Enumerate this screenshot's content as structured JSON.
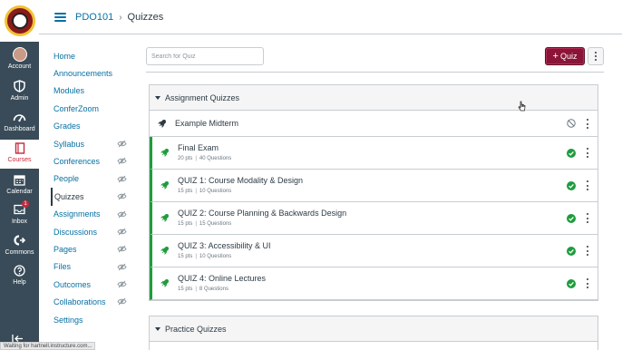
{
  "global_nav": {
    "items": [
      {
        "label": "Account",
        "icon": "avatar"
      },
      {
        "label": "Admin",
        "icon": "shield-icon"
      },
      {
        "label": "Dashboard",
        "icon": "dashboard-icon"
      },
      {
        "label": "Courses",
        "icon": "book-icon"
      },
      {
        "label": "Calendar",
        "icon": "calendar-icon"
      },
      {
        "label": "Inbox",
        "icon": "inbox-icon",
        "badge": "1"
      },
      {
        "label": "Commons",
        "icon": "commons-icon"
      },
      {
        "label": "Help",
        "icon": "help-icon"
      }
    ],
    "active": "Courses"
  },
  "header": {
    "course": "PDO101",
    "page": "Quizzes"
  },
  "course_nav": {
    "items": [
      {
        "label": "Home",
        "hidden": false
      },
      {
        "label": "Announcements",
        "hidden": false
      },
      {
        "label": "Modules",
        "hidden": false
      },
      {
        "label": "ConferZoom",
        "hidden": false
      },
      {
        "label": "Grades",
        "hidden": false
      },
      {
        "label": "Syllabus",
        "hidden": true
      },
      {
        "label": "Conferences",
        "hidden": true
      },
      {
        "label": "People",
        "hidden": true
      },
      {
        "label": "Quizzes",
        "hidden": true,
        "active": true
      },
      {
        "label": "Assignments",
        "hidden": true
      },
      {
        "label": "Discussions",
        "hidden": true
      },
      {
        "label": "Pages",
        "hidden": true
      },
      {
        "label": "Files",
        "hidden": true
      },
      {
        "label": "Outcomes",
        "hidden": true
      },
      {
        "label": "Collaborations",
        "hidden": true
      },
      {
        "label": "Settings",
        "hidden": false
      }
    ]
  },
  "toolbar": {
    "search_placeholder": "Search for Quiz",
    "add_quiz_label": "Quiz"
  },
  "assignment_group": {
    "title": "Assignment Quizzes",
    "quizzes": [
      {
        "title": "Example Midterm",
        "points": "",
        "questions": "",
        "published": false
      },
      {
        "title": "Final Exam",
        "points": "20 pts",
        "questions": "40 Questions",
        "published": true
      },
      {
        "title": "QUIZ 1: Course Modality & Design",
        "points": "15 pts",
        "questions": "10 Questions",
        "published": true
      },
      {
        "title": "QUIZ 2: Course Planning & Backwards Design",
        "points": "15 pts",
        "questions": "15 Questions",
        "published": true
      },
      {
        "title": "QUIZ 3: Accessibility & UI",
        "points": "15 pts",
        "questions": "10 Questions",
        "published": true
      },
      {
        "title": "QUIZ 4: Online Lectures",
        "points": "15 pts",
        "questions": "8 Questions",
        "published": true
      }
    ]
  },
  "practice_group": {
    "title": "Practice Quizzes"
  },
  "browser_status": "Waiting for hartnell.instructure.com...",
  "colors": {
    "global_nav_bg": "#394b58",
    "link": "#0770a3",
    "primary_button": "#8b1538",
    "published": "#1f9c3e",
    "active_nav": "#c42b3c"
  }
}
